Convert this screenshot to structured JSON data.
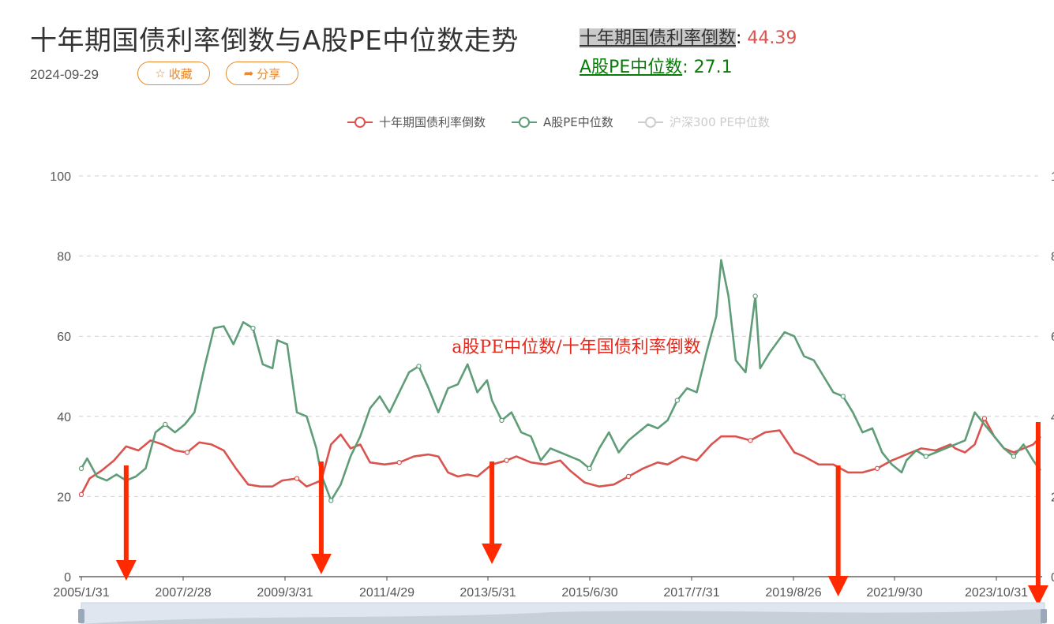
{
  "header": {
    "title": "十年期国债利率倒数与A股PE中位数走势",
    "date": "2024-09-29",
    "fav_label": "收藏",
    "share_label": "分享"
  },
  "current_values": {
    "bond_label": "十年期国债利率倒数",
    "bond_value": "44.39",
    "pe_label": "A股PE中位数",
    "pe_value": "27.1"
  },
  "annotation": "a股PE中位数/十年国债利率倒数",
  "colors": {
    "bond": "#d9534f",
    "pe": "#5f9c78",
    "disabled": "#cccccc",
    "arrow": "#ff2a00"
  },
  "chart_data": {
    "type": "line",
    "legend": [
      {
        "name": "十年期国债利率倒数",
        "active": true
      },
      {
        "name": "A股PE中位数",
        "active": true
      },
      {
        "name": "沪深300 PE中位数",
        "active": false
      }
    ],
    "ylim": [
      0,
      100
    ],
    "yticks": [
      "0",
      "20",
      "40",
      "60",
      "80",
      "100"
    ],
    "xlim": [
      2005.08,
      2024.75
    ],
    "xticks": [
      "2005/1/31",
      "2007/2/28",
      "2009/3/31",
      "2011/4/29",
      "2013/5/31",
      "2015/6/30",
      "2017/7/31",
      "2019/8/26",
      "2021/9/30",
      "2023/10/31"
    ],
    "grid": true,
    "series": [
      {
        "name": "十年期国债利率倒数",
        "points": [
          [
            2005.08,
            20.5
          ],
          [
            2005.25,
            24.5
          ],
          [
            2005.5,
            26.5
          ],
          [
            2005.75,
            29
          ],
          [
            2006.0,
            32.5
          ],
          [
            2006.25,
            31.5
          ],
          [
            2006.5,
            34
          ],
          [
            2006.75,
            33
          ],
          [
            2007.0,
            31.5
          ],
          [
            2007.25,
            31
          ],
          [
            2007.5,
            33.5
          ],
          [
            2007.75,
            33
          ],
          [
            2008.0,
            31.5
          ],
          [
            2008.25,
            27
          ],
          [
            2008.5,
            23
          ],
          [
            2008.75,
            22.5
          ],
          [
            2009.0,
            22.5
          ],
          [
            2009.2,
            24
          ],
          [
            2009.5,
            24.5
          ],
          [
            2009.7,
            22.5
          ],
          [
            2010.0,
            24
          ],
          [
            2010.2,
            33
          ],
          [
            2010.4,
            35.5
          ],
          [
            2010.6,
            32
          ],
          [
            2010.8,
            33
          ],
          [
            2011.0,
            28.5
          ],
          [
            2011.3,
            28
          ],
          [
            2011.6,
            28.5
          ],
          [
            2011.9,
            30
          ],
          [
            2012.2,
            30.5
          ],
          [
            2012.4,
            30
          ],
          [
            2012.6,
            26
          ],
          [
            2012.8,
            25
          ],
          [
            2013.0,
            25.5
          ],
          [
            2013.2,
            25
          ],
          [
            2013.5,
            28
          ],
          [
            2013.8,
            29
          ],
          [
            2014.0,
            30
          ],
          [
            2014.3,
            28.5
          ],
          [
            2014.6,
            28
          ],
          [
            2014.9,
            29
          ],
          [
            2015.1,
            26.5
          ],
          [
            2015.4,
            23.5
          ],
          [
            2015.7,
            22.5
          ],
          [
            2016.0,
            23
          ],
          [
            2016.3,
            25
          ],
          [
            2016.6,
            27
          ],
          [
            2016.9,
            28.5
          ],
          [
            2017.1,
            28
          ],
          [
            2017.4,
            30
          ],
          [
            2017.7,
            29
          ],
          [
            2018.0,
            33
          ],
          [
            2018.2,
            35
          ],
          [
            2018.5,
            35
          ],
          [
            2018.8,
            34
          ],
          [
            2019.1,
            36
          ],
          [
            2019.4,
            36.5
          ],
          [
            2019.7,
            31
          ],
          [
            2019.9,
            30
          ],
          [
            2020.2,
            28
          ],
          [
            2020.5,
            28
          ],
          [
            2020.8,
            26
          ],
          [
            2021.1,
            26
          ],
          [
            2021.4,
            27
          ],
          [
            2021.7,
            29
          ],
          [
            2022.0,
            30.5
          ],
          [
            2022.3,
            32
          ],
          [
            2022.6,
            31.5
          ],
          [
            2022.9,
            33
          ],
          [
            2023.0,
            32
          ],
          [
            2023.2,
            31
          ],
          [
            2023.4,
            33
          ],
          [
            2023.6,
            39.5
          ],
          [
            2023.8,
            35
          ],
          [
            2024.0,
            32
          ],
          [
            2024.2,
            31
          ],
          [
            2024.4,
            32
          ],
          [
            2024.6,
            33
          ],
          [
            2024.75,
            35
          ]
        ]
      },
      {
        "name": "A股PE中位数",
        "points": [
          [
            2005.08,
            27
          ],
          [
            2005.2,
            29.5
          ],
          [
            2005.4,
            25
          ],
          [
            2005.6,
            24
          ],
          [
            2005.8,
            25.5
          ],
          [
            2006.0,
            24
          ],
          [
            2006.2,
            25
          ],
          [
            2006.4,
            27
          ],
          [
            2006.6,
            36
          ],
          [
            2006.8,
            38
          ],
          [
            2007.0,
            36
          ],
          [
            2007.2,
            38
          ],
          [
            2007.4,
            41
          ],
          [
            2007.6,
            52
          ],
          [
            2007.8,
            62
          ],
          [
            2008.0,
            62.5
          ],
          [
            2008.2,
            58
          ],
          [
            2008.4,
            63.5
          ],
          [
            2008.6,
            62
          ],
          [
            2008.8,
            53
          ],
          [
            2009.0,
            52
          ],
          [
            2009.1,
            59
          ],
          [
            2009.3,
            58
          ],
          [
            2009.5,
            41
          ],
          [
            2009.7,
            40
          ],
          [
            2009.9,
            32
          ],
          [
            2010.0,
            25.5
          ],
          [
            2010.2,
            19
          ],
          [
            2010.4,
            23
          ],
          [
            2010.6,
            30
          ],
          [
            2010.8,
            35
          ],
          [
            2011.0,
            42
          ],
          [
            2011.2,
            45
          ],
          [
            2011.4,
            41
          ],
          [
            2011.6,
            46
          ],
          [
            2011.8,
            51
          ],
          [
            2012.0,
            52.5
          ],
          [
            2012.2,
            47
          ],
          [
            2012.4,
            41
          ],
          [
            2012.6,
            47
          ],
          [
            2012.8,
            48
          ],
          [
            2013.0,
            53
          ],
          [
            2013.2,
            46
          ],
          [
            2013.4,
            49
          ],
          [
            2013.5,
            44
          ],
          [
            2013.7,
            39
          ],
          [
            2013.9,
            41
          ],
          [
            2014.1,
            36
          ],
          [
            2014.3,
            35
          ],
          [
            2014.5,
            29
          ],
          [
            2014.7,
            32
          ],
          [
            2014.9,
            31
          ],
          [
            2015.1,
            30
          ],
          [
            2015.3,
            29
          ],
          [
            2015.5,
            27
          ],
          [
            2015.7,
            32
          ],
          [
            2015.9,
            36
          ],
          [
            2016.1,
            31
          ],
          [
            2016.3,
            34
          ],
          [
            2016.5,
            36
          ],
          [
            2016.7,
            38
          ],
          [
            2016.9,
            37
          ],
          [
            2017.1,
            39
          ],
          [
            2017.3,
            44
          ],
          [
            2017.5,
            47
          ],
          [
            2017.7,
            46
          ],
          [
            2017.9,
            56
          ],
          [
            2018.1,
            65
          ],
          [
            2018.2,
            79
          ],
          [
            2018.35,
            70
          ],
          [
            2018.5,
            54
          ],
          [
            2018.7,
            51
          ],
          [
            2018.9,
            70
          ],
          [
            2019.0,
            52
          ],
          [
            2019.2,
            56
          ],
          [
            2019.5,
            61
          ],
          [
            2019.7,
            60
          ],
          [
            2019.9,
            55
          ],
          [
            2020.1,
            54
          ],
          [
            2020.3,
            50
          ],
          [
            2020.5,
            46
          ],
          [
            2020.7,
            45
          ],
          [
            2020.9,
            41
          ],
          [
            2021.1,
            36
          ],
          [
            2021.3,
            37
          ],
          [
            2021.5,
            31
          ],
          [
            2021.7,
            28
          ],
          [
            2021.9,
            26
          ],
          [
            2022.0,
            29
          ],
          [
            2022.2,
            31.5
          ],
          [
            2022.4,
            30
          ],
          [
            2022.6,
            31
          ],
          [
            2022.8,
            32
          ],
          [
            2023.0,
            33
          ],
          [
            2023.2,
            34
          ],
          [
            2023.4,
            41
          ],
          [
            2023.6,
            38
          ],
          [
            2023.8,
            35
          ],
          [
            2024.0,
            32
          ],
          [
            2024.2,
            30
          ],
          [
            2024.4,
            33
          ],
          [
            2024.6,
            29
          ],
          [
            2024.75,
            26.5
          ]
        ]
      }
    ],
    "arrow_x": [
      2006.0,
      2010.0,
      2013.5,
      2020.6,
      2024.7
    ],
    "arrow_value": 0
  }
}
